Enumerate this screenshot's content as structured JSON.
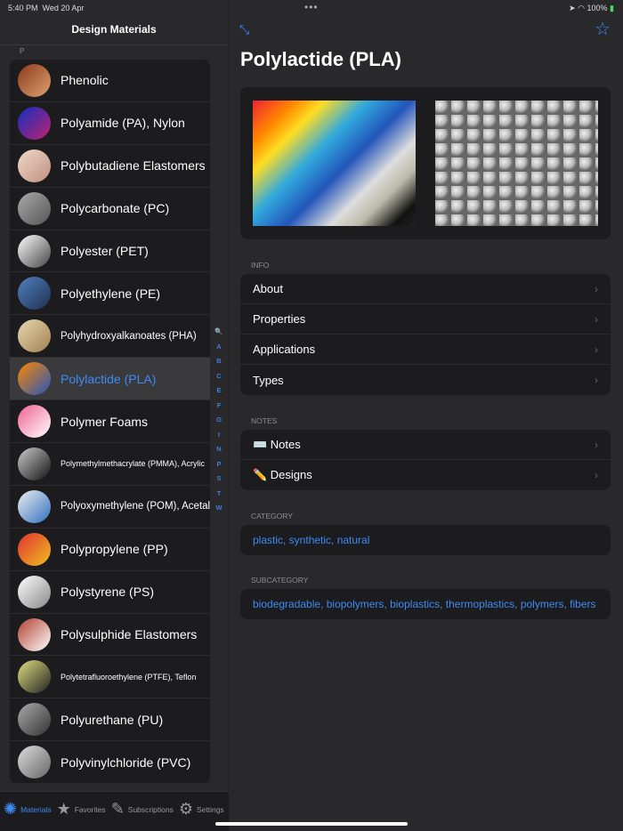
{
  "status": {
    "time": "5:40 PM",
    "date": "Wed 20 Apr",
    "battery": "100%"
  },
  "sidebar": {
    "title": "Design Materials",
    "section": "P",
    "items": [
      {
        "label": "Phenolic",
        "size": "",
        "c1": "#8a3a1a",
        "c2": "#e0a070"
      },
      {
        "label": "Polyamide (PA), Nylon",
        "size": "",
        "c1": "#1030c0",
        "c2": "#c02070"
      },
      {
        "label": "Polybutadiene Elastomers",
        "size": "",
        "c1": "#f0d8c8",
        "c2": "#c09080"
      },
      {
        "label": "Polycarbonate (PC)",
        "size": "",
        "c1": "#aaa",
        "c2": "#555"
      },
      {
        "label": "Polyester (PET)",
        "size": "",
        "c1": "#fff",
        "c2": "#444"
      },
      {
        "label": "Polyethylene (PE)",
        "size": "",
        "c1": "#5080c0",
        "c2": "#203050"
      },
      {
        "label": "Polyhydroxyalkanoates (PHA)",
        "size": "sm",
        "c1": "#e8d8b0",
        "c2": "#a08050"
      },
      {
        "label": "Polylactide (PLA)",
        "size": "",
        "c1": "#f80",
        "c2": "#25b"
      },
      {
        "label": "Polymer Foams",
        "size": "",
        "c1": "#f06090",
        "c2": "#fff"
      },
      {
        "label": "Polymethylmethacrylate (PMMA), Acrylic",
        "size": "xs",
        "c1": "#ccc",
        "c2": "#111"
      },
      {
        "label": "Polyoxymethylene (POM), Acetal",
        "size": "sm",
        "c1": "#eee",
        "c2": "#3070c0"
      },
      {
        "label": "Polypropylene (PP)",
        "size": "",
        "c1": "#e03030",
        "c2": "#f0c020"
      },
      {
        "label": "Polystyrene (PS)",
        "size": "",
        "c1": "#fff",
        "c2": "#888"
      },
      {
        "label": "Polysulphide Elastomers",
        "size": "",
        "c1": "#b04030",
        "c2": "#fff"
      },
      {
        "label": "Polytetrafluoroethylene (PTFE), Teflon",
        "size": "xs",
        "c1": "#e0e080",
        "c2": "#222"
      },
      {
        "label": "Polyurethane (PU)",
        "size": "",
        "c1": "#aaa",
        "c2": "#333"
      },
      {
        "label": "Polyvinylchloride (PVC)",
        "size": "",
        "c1": "#ddd",
        "c2": "#666"
      }
    ],
    "selected": 7,
    "index": [
      "🔍",
      "A",
      "B",
      "C",
      "E",
      "F",
      "G",
      "I",
      "N",
      "P",
      "S",
      "T",
      "W"
    ]
  },
  "tabs": [
    {
      "label": "Materials",
      "icon": "aperture"
    },
    {
      "label": "Favorites",
      "icon": "★"
    },
    {
      "label": "Subscriptions",
      "icon": "✎"
    },
    {
      "label": "Settings",
      "icon": "⚙"
    }
  ],
  "detail": {
    "title": "Polylactide (PLA)",
    "info_header": "INFO",
    "info": [
      "About",
      "Properties",
      "Applications",
      "Types"
    ],
    "notes_header": "NOTES",
    "notes": [
      "⌨️ Notes",
      "✏️ Designs"
    ],
    "category_header": "CATEGORY",
    "category": "plastic, synthetic, natural",
    "subcategory_header": "SUBCATEGORY",
    "subcategory": "biodegradable, biopolymers, bioplastics, thermoplastics, polymers, fibers"
  },
  "accent": "#3d8af7"
}
